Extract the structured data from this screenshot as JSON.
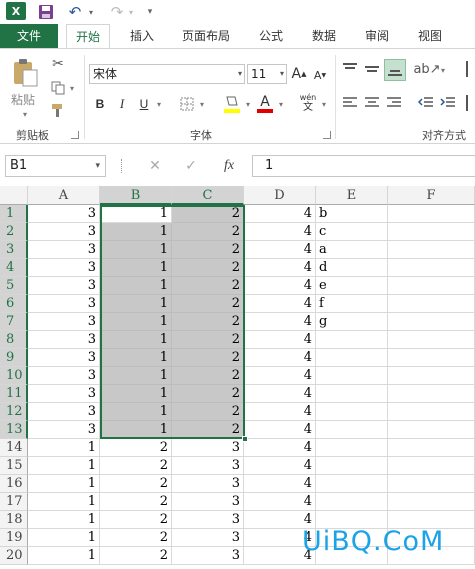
{
  "app": {
    "logo_letter": "X"
  },
  "colors": {
    "brand": "#217346",
    "selection_fill": "#c8c8c8",
    "watermark": "#1aa3e6"
  },
  "tabs": [
    "文件",
    "开始",
    "插入",
    "页面布局",
    "公式",
    "数据",
    "审阅",
    "视图"
  ],
  "ribbon": {
    "clipboard": {
      "label": "剪贴板",
      "paste_label": "粘贴"
    },
    "font": {
      "label": "字体",
      "font_name": "宋体",
      "font_size": "11",
      "grow": "A",
      "shrink": "A",
      "bold": "B",
      "italic": "I",
      "underline": "U",
      "font_color_glyph": "A",
      "wen": "wén"
    },
    "alignment": {
      "label": "对齐方式"
    }
  },
  "formula_bar": {
    "name_box": "B1",
    "fx": "fx",
    "value": "1"
  },
  "grid": {
    "columns": [
      "A",
      "B",
      "C",
      "D",
      "E",
      "F"
    ],
    "rows": [
      {
        "n": "1",
        "a": "3",
        "b": "1",
        "c": "2",
        "d": "4",
        "e": "b"
      },
      {
        "n": "2",
        "a": "3",
        "b": "1",
        "c": "2",
        "d": "4",
        "e": "c"
      },
      {
        "n": "3",
        "a": "3",
        "b": "1",
        "c": "2",
        "d": "4",
        "e": "a"
      },
      {
        "n": "4",
        "a": "3",
        "b": "1",
        "c": "2",
        "d": "4",
        "e": "d"
      },
      {
        "n": "5",
        "a": "3",
        "b": "1",
        "c": "2",
        "d": "4",
        "e": "e"
      },
      {
        "n": "6",
        "a": "3",
        "b": "1",
        "c": "2",
        "d": "4",
        "e": "f"
      },
      {
        "n": "7",
        "a": "3",
        "b": "1",
        "c": "2",
        "d": "4",
        "e": "g"
      },
      {
        "n": "8",
        "a": "3",
        "b": "1",
        "c": "2",
        "d": "4",
        "e": ""
      },
      {
        "n": "9",
        "a": "3",
        "b": "1",
        "c": "2",
        "d": "4",
        "e": ""
      },
      {
        "n": "10",
        "a": "3",
        "b": "1",
        "c": "2",
        "d": "4",
        "e": ""
      },
      {
        "n": "11",
        "a": "3",
        "b": "1",
        "c": "2",
        "d": "4",
        "e": ""
      },
      {
        "n": "12",
        "a": "3",
        "b": "1",
        "c": "2",
        "d": "4",
        "e": ""
      },
      {
        "n": "13",
        "a": "3",
        "b": "1",
        "c": "2",
        "d": "4",
        "e": ""
      },
      {
        "n": "14",
        "a": "1",
        "b": "2",
        "c": "3",
        "d": "4",
        "e": ""
      },
      {
        "n": "15",
        "a": "1",
        "b": "2",
        "c": "3",
        "d": "4",
        "e": ""
      },
      {
        "n": "16",
        "a": "1",
        "b": "2",
        "c": "3",
        "d": "4",
        "e": ""
      },
      {
        "n": "17",
        "a": "1",
        "b": "2",
        "c": "3",
        "d": "4",
        "e": ""
      },
      {
        "n": "18",
        "a": "1",
        "b": "2",
        "c": "3",
        "d": "4",
        "e": ""
      },
      {
        "n": "19",
        "a": "1",
        "b": "2",
        "c": "3",
        "d": "4",
        "e": ""
      },
      {
        "n": "20",
        "a": "1",
        "b": "2",
        "c": "3",
        "d": "4",
        "e": ""
      }
    ]
  },
  "watermark": "UiBQ.CoM"
}
